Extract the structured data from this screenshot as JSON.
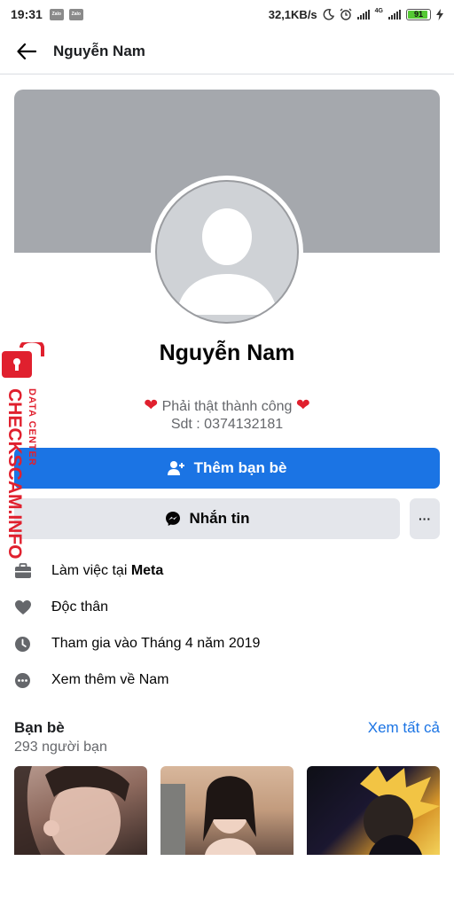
{
  "status": {
    "time": "19:31",
    "apps": [
      "Zalo",
      "Zalo"
    ],
    "speed": "32,1KB/s",
    "network": "4G",
    "battery": "91"
  },
  "header": {
    "title": "Nguyễn Nam"
  },
  "profile": {
    "name": "Nguyễn Nam",
    "bio_line1": "Phải thật thành công",
    "bio_line2": "Sdt : 0374132181"
  },
  "actions": {
    "add_friend": "Thêm bạn bè",
    "message": "Nhắn tin",
    "more": "···"
  },
  "info": {
    "work_prefix": "Làm việc tại ",
    "work_place": "Meta",
    "relationship": "Độc thân",
    "joined": "Tham gia vào Tháng 4 năm 2019",
    "see_more": "Xem thêm về Nam"
  },
  "friends": {
    "title": "Bạn bè",
    "count": "293 người bạn",
    "see_all": "Xem tất cả"
  },
  "watermark": {
    "brand": "CHECKSCAM.INFO",
    "tagline": "DATA CENTER"
  },
  "colors": {
    "accent": "#1b74e4",
    "cover": "#a5a8ad",
    "secondary_button": "#e4e6eb",
    "watermark": "#e0202e"
  }
}
